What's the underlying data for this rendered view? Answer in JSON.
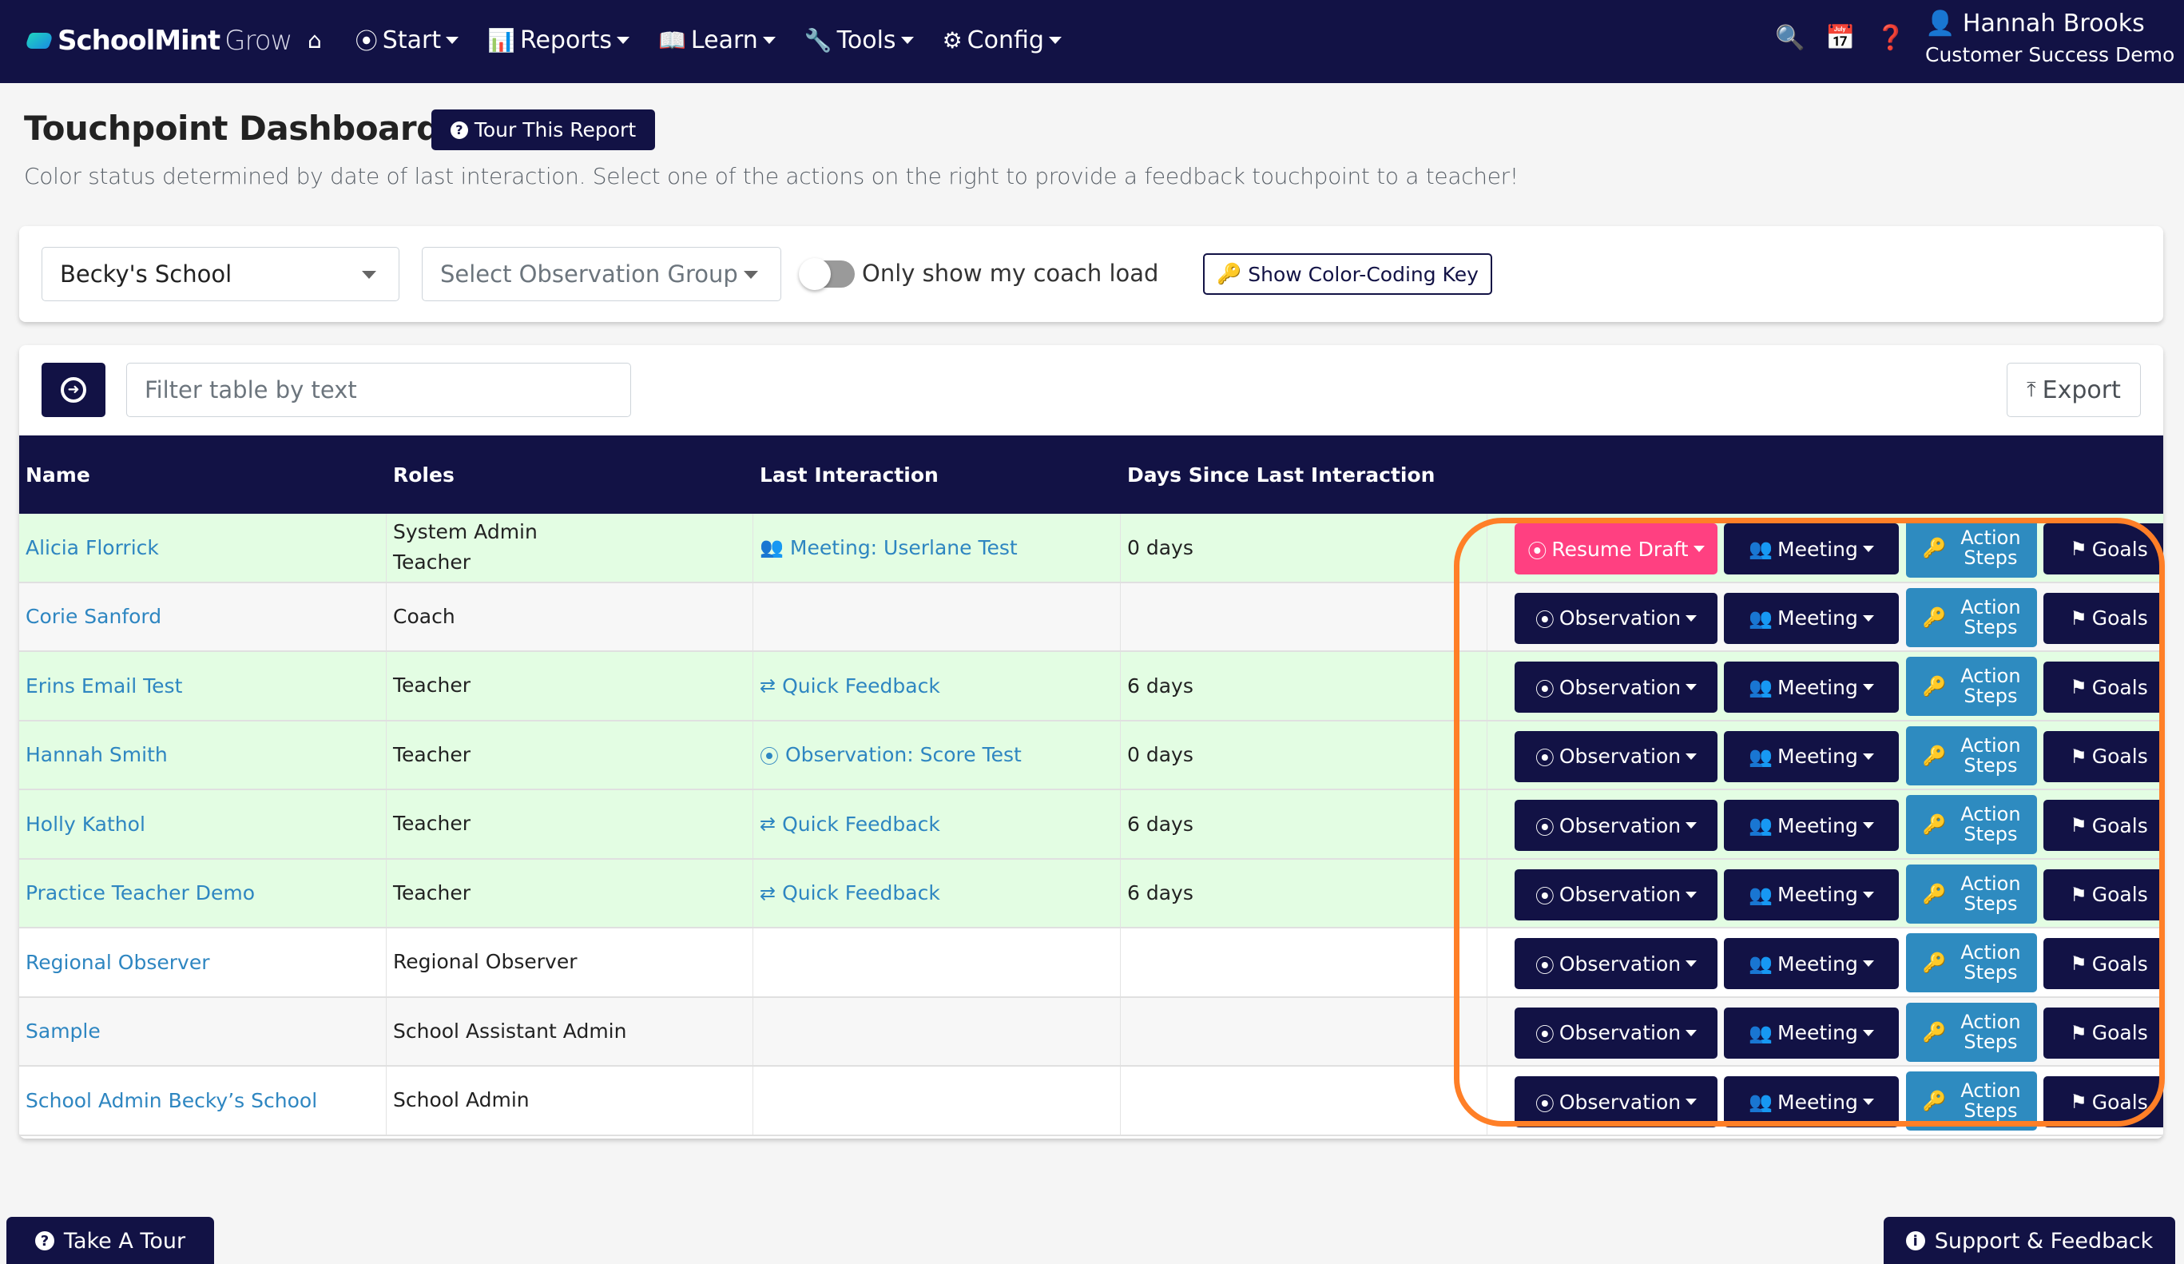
{
  "navbar": {
    "brand_bold": "SchoolMint",
    "brand_light": "Grow",
    "items": [
      {
        "label": "Start",
        "icon": "compass-icon"
      },
      {
        "label": "Reports",
        "icon": "bar-chart-icon"
      },
      {
        "label": "Learn",
        "icon": "book-icon"
      },
      {
        "label": "Tools",
        "icon": "wrench-icon"
      },
      {
        "label": "Config",
        "icon": "gear-icon"
      }
    ],
    "user_name": "Hannah Brooks",
    "user_org": "Customer Success Demo"
  },
  "header": {
    "title": "Touchpoint Dashboard",
    "tour_button": "Tour This Report",
    "description": "Color status determined by date of last interaction. Select one of the actions on the right to provide a feedback touchpoint to a teacher!"
  },
  "filters": {
    "school_value": "Becky's School",
    "group_placeholder": "Select Observation Group",
    "coach_load_label": "Only show my coach load",
    "coach_load_on": false,
    "color_key_button": "Show Color-Coding Key"
  },
  "table_toolbar": {
    "filter_placeholder": "Filter table by text",
    "export_label": "Export"
  },
  "table": {
    "columns": [
      "Name",
      "Roles",
      "Last Interaction",
      "Days Since Last Interaction"
    ],
    "rows": [
      {
        "name": "Alicia Florrick",
        "roles": [
          "System Admin",
          "Teacher"
        ],
        "last_interaction": "Meeting: Userlane Test",
        "interaction_type": "meeting",
        "days": "0 days",
        "status": "green",
        "primary_action": "Resume Draft"
      },
      {
        "name": "Corie Sanford",
        "roles": [
          "Coach"
        ],
        "last_interaction": "",
        "interaction_type": "",
        "days": "",
        "status": "grey",
        "primary_action": "Observation"
      },
      {
        "name": "Erins Email Test",
        "roles": [
          "Teacher"
        ],
        "last_interaction": "Quick Feedback",
        "interaction_type": "quick",
        "days": "6 days",
        "status": "green",
        "primary_action": "Observation"
      },
      {
        "name": "Hannah Smith",
        "roles": [
          "Teacher"
        ],
        "last_interaction": "Observation: Score Test",
        "interaction_type": "observation",
        "days": "0 days",
        "status": "green",
        "primary_action": "Observation"
      },
      {
        "name": "Holly Kathol",
        "roles": [
          "Teacher"
        ],
        "last_interaction": "Quick Feedback",
        "interaction_type": "quick",
        "days": "6 days",
        "status": "green",
        "primary_action": "Observation"
      },
      {
        "name": "Practice Teacher Demo",
        "roles": [
          "Teacher"
        ],
        "last_interaction": "Quick Feedback",
        "interaction_type": "quick",
        "days": "6 days",
        "status": "green",
        "primary_action": "Observation"
      },
      {
        "name": "Regional Observer",
        "roles": [
          "Regional Observer"
        ],
        "last_interaction": "",
        "interaction_type": "",
        "days": "",
        "status": "white",
        "primary_action": "Observation"
      },
      {
        "name": "Sample",
        "roles": [
          "School Assistant Admin"
        ],
        "last_interaction": "",
        "interaction_type": "",
        "days": "",
        "status": "grey",
        "primary_action": "Observation"
      },
      {
        "name": "School Admin Becky’s School",
        "roles": [
          "School Admin"
        ],
        "last_interaction": "",
        "interaction_type": "",
        "days": "",
        "status": "white",
        "primary_action": "Observation"
      }
    ],
    "action_labels": {
      "meeting": "Meeting",
      "action_steps_line1": "Action",
      "action_steps_line2": "Steps",
      "goals": "Goals"
    }
  },
  "footer": {
    "take_tour": "Take A Tour",
    "support": "Support & Feedback"
  },
  "colors": {
    "navy": "#121245",
    "link_blue": "#2e86c1",
    "action_steps_blue": "#2e8bc0",
    "resume_draft_pink": "#ff4081",
    "row_green": "#e3fde3",
    "highlight_orange": "#ff7f27"
  }
}
